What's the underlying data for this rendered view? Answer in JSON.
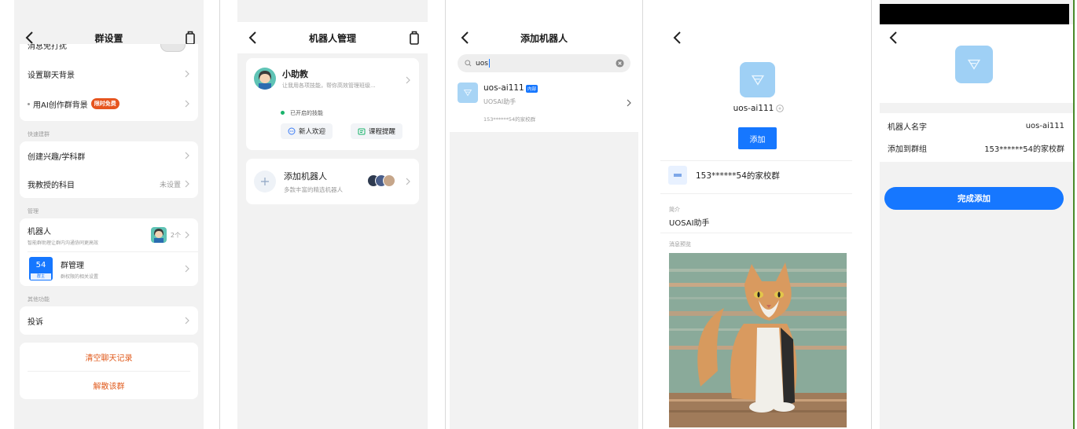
{
  "colors": {
    "panel_bg": "#f2f2f2",
    "accent_blue": "#1677ff",
    "danger_orange": "#e05a1c",
    "green": "#19b36b"
  },
  "screen1": {
    "title": "群设置",
    "partial_top": "消息免打扰",
    "row_chat_bg": "设置聊天背景",
    "row_ai_bg": "用AI创作群背景",
    "ai_badge": "限时免费",
    "section_quick": "快速建群",
    "row_interest_group": "创建兴趣/学科群",
    "row_subject": "我教授的科目",
    "row_subject_value": "未设置",
    "section_manage": "管理",
    "row_robot": "机器人",
    "row_robot_sub": "智能群助理让群内沟通协同更高效",
    "row_robot_count": "2个",
    "group_num": "54",
    "group_owner_tag": "群主",
    "row_group_manage": "群管理",
    "row_group_manage_sub": "群权限的相关设置",
    "section_other": "其他功能",
    "row_report": "投诉",
    "clear_history": "清空聊天记录",
    "dissolve": "解散该群"
  },
  "screen2": {
    "title": "机器人管理",
    "assistant_name": "小助教",
    "assistant_desc": "让我用各项技能，帮你高效管理班级...",
    "skills_label": "已开启的技能",
    "skill1": "新人欢迎",
    "skill2": "课程提醒",
    "add_robot": "添加机器人",
    "add_robot_sub": "多款丰富的精选机器人"
  },
  "screen3": {
    "title": "添加机器人",
    "search_value": "uos",
    "result_name": "uos-ai111",
    "result_tag": "内部",
    "result_desc": "UOSAI助手",
    "result_group": "153******54的家校群"
  },
  "screen4": {
    "bot_name": "uos-ai111",
    "add_button": "添加",
    "group_name": "153******54的家校群",
    "intro_label": "简介",
    "intro_value": "UOSAI助手",
    "preview_label": "消息预览"
  },
  "screen5": {
    "label_name": "机器人名字",
    "value_name": "uos-ai111",
    "label_group": "添加到群组",
    "value_group": "153******54的家校群",
    "finish_button": "完成添加"
  }
}
